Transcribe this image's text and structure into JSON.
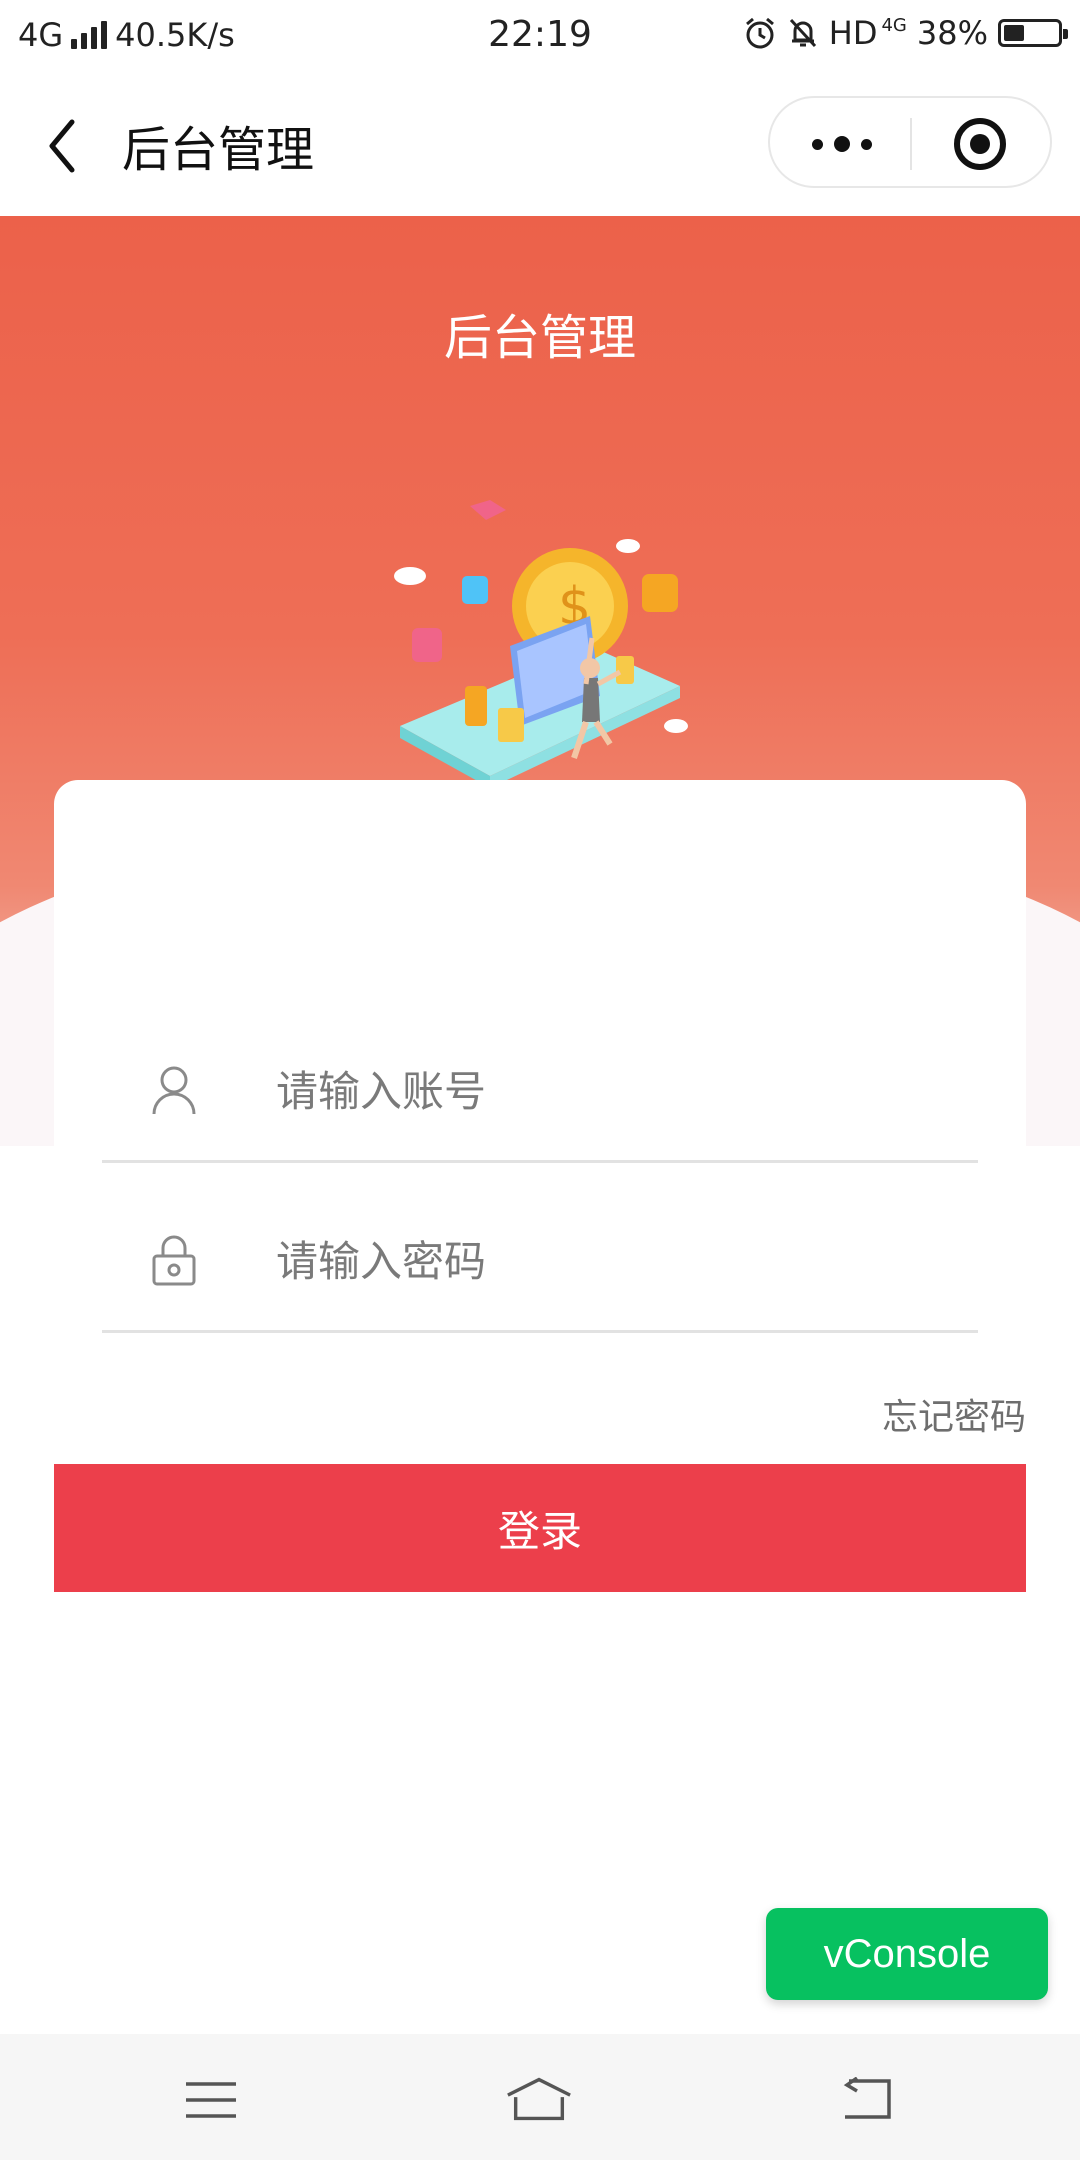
{
  "status_bar": {
    "network": "4G",
    "speed": "40.5K/s",
    "time": "22:19",
    "hd": "HD",
    "hd_network": "4G",
    "battery_percent": "38%",
    "battery_level": 0.38,
    "icons": [
      "signal-icon",
      "alarm-icon",
      "mute-bell-icon",
      "battery-icon"
    ]
  },
  "title_bar": {
    "back_icon": "chevron-left-icon",
    "title": "后台管理",
    "more_icon": "more-dots-icon",
    "close_icon": "target-circle-icon"
  },
  "hero": {
    "title": "后台管理",
    "illustration": "phone-coins-illustration"
  },
  "login_form": {
    "account": {
      "icon": "user-icon",
      "placeholder": "请输入账号",
      "value": ""
    },
    "password": {
      "icon": "lock-icon",
      "placeholder": "请输入密码",
      "value": ""
    },
    "forgot_label": "忘记密码",
    "submit_label": "登录"
  },
  "vconsole": {
    "label": "vConsole"
  },
  "nav_bar": {
    "icons": [
      "menu-icon",
      "home-icon",
      "back-icon"
    ]
  },
  "colors": {
    "hero_red": "#ec614a",
    "login_red": "#ec3f4b",
    "vconsole_green": "#07c160"
  }
}
